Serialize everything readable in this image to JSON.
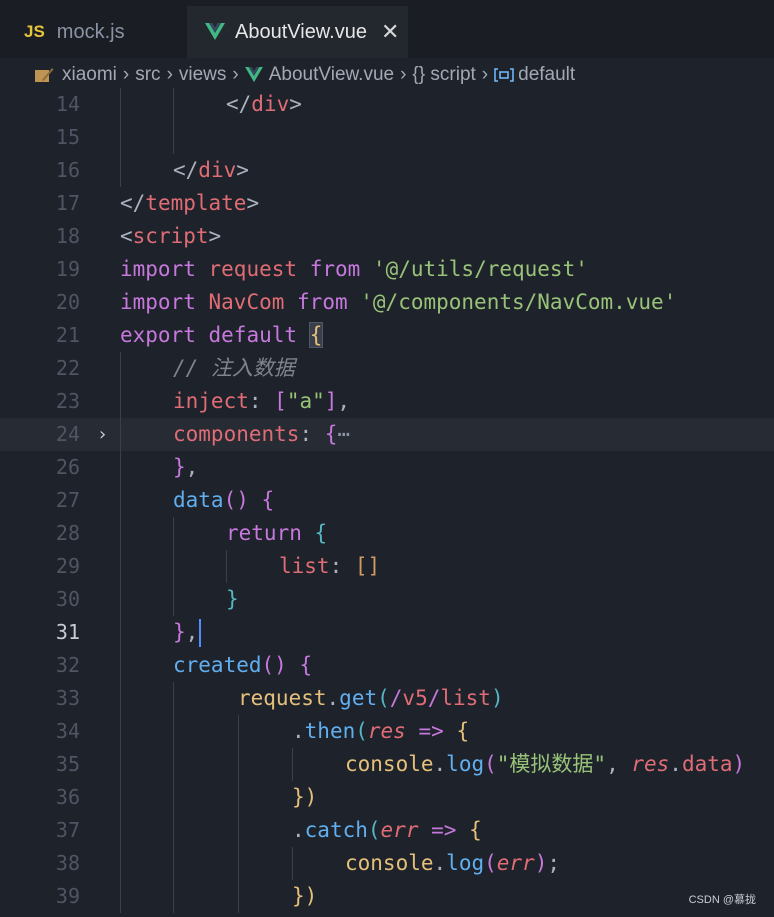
{
  "tabs": [
    {
      "icon": "js-icon",
      "icon_text": "JS",
      "label": "mock.js",
      "active": false
    },
    {
      "icon": "vue-icon",
      "label": "AboutView.vue",
      "active": true,
      "close": "✕"
    }
  ],
  "breadcrumb": [
    "xiaomi",
    "src",
    "views",
    "AboutView.vue",
    "{} script",
    "default"
  ],
  "colors": {
    "background": "#1e222a",
    "keyword": "#c678dd",
    "variable": "#e06c75",
    "string": "#98c379",
    "function": "#61afef",
    "comment": "#7f848e",
    "vue_green": "#41b883",
    "js_yellow": "#e8c53b"
  },
  "editor": {
    "active_line": "31",
    "lines": [
      {
        "n": "14",
        "tokens": [
          [
            "p",
            "</"
          ],
          [
            "tag",
            "div"
          ],
          [
            "p",
            ">"
          ]
        ]
      },
      {
        "n": "15",
        "tokens": []
      },
      {
        "n": "16",
        "tokens": [
          [
            "p",
            "</"
          ],
          [
            "tag",
            "div"
          ],
          [
            "p",
            ">"
          ]
        ]
      },
      {
        "n": "17",
        "tokens": [
          [
            "p",
            "</"
          ],
          [
            "tag",
            "template"
          ],
          [
            "p",
            ">"
          ]
        ]
      },
      {
        "n": "18",
        "tokens": [
          [
            "p",
            "<"
          ],
          [
            "tag",
            "script"
          ],
          [
            "p",
            ">"
          ]
        ]
      },
      {
        "n": "19",
        "tokens": [
          [
            "kw",
            "import"
          ],
          [
            "p",
            " "
          ],
          [
            "var",
            "request"
          ],
          [
            "p",
            " "
          ],
          [
            "kw",
            "from"
          ],
          [
            "p",
            " "
          ],
          [
            "str",
            "'@/utils/request'"
          ]
        ]
      },
      {
        "n": "20",
        "tokens": [
          [
            "kw",
            "import"
          ],
          [
            "p",
            " "
          ],
          [
            "var",
            "NavCom"
          ],
          [
            "p",
            " "
          ],
          [
            "kw",
            "from"
          ],
          [
            "p",
            " "
          ],
          [
            "str",
            "'@/components/NavCom.vue'"
          ]
        ]
      },
      {
        "n": "21",
        "tokens": [
          [
            "kw",
            "export"
          ],
          [
            "p",
            " "
          ],
          [
            "kw",
            "default"
          ],
          [
            "p",
            " "
          ],
          [
            "b1br",
            "{"
          ]
        ]
      },
      {
        "n": "22",
        "tokens": [
          [
            "com",
            "// 注入数据"
          ]
        ]
      },
      {
        "n": "23",
        "tokens": [
          [
            "prop",
            "inject"
          ],
          [
            "p",
            ": "
          ],
          [
            "b2",
            "["
          ],
          [
            "str",
            "\"a\""
          ],
          [
            "b2",
            "]"
          ],
          [
            "p",
            ","
          ]
        ]
      },
      {
        "n": "24",
        "tokens": [
          [
            "prop",
            "components"
          ],
          [
            "p",
            ": "
          ],
          [
            "b2",
            "{"
          ],
          [
            "fold",
            "⋯"
          ]
        ]
      },
      {
        "n": "26",
        "tokens": [
          [
            "b2",
            "}"
          ],
          [
            "p",
            ","
          ]
        ]
      },
      {
        "n": "27",
        "tokens": [
          [
            "fn",
            "data"
          ],
          [
            "b2",
            "()"
          ],
          [
            "p",
            " "
          ],
          [
            "b2",
            "{"
          ]
        ]
      },
      {
        "n": "28",
        "tokens": [
          [
            "kw",
            "return"
          ],
          [
            "p",
            " "
          ],
          [
            "b3",
            "{"
          ]
        ]
      },
      {
        "n": "29",
        "tokens": [
          [
            "prop",
            "list"
          ],
          [
            "p",
            ": "
          ],
          [
            "num",
            "[]"
          ]
        ]
      },
      {
        "n": "30",
        "tokens": [
          [
            "b3",
            "}"
          ]
        ]
      },
      {
        "n": "31",
        "tokens": [
          [
            "b2",
            "}"
          ],
          [
            "p",
            ","
          ]
        ]
      },
      {
        "n": "32",
        "tokens": [
          [
            "fn",
            "created"
          ],
          [
            "b2",
            "()"
          ],
          [
            "p",
            " "
          ],
          [
            "b2",
            "{"
          ]
        ]
      },
      {
        "n": "33",
        "tokens": [
          [
            "obj",
            "request"
          ],
          [
            "p",
            "."
          ],
          [
            "fn",
            "get"
          ],
          [
            "b3",
            "("
          ],
          [
            "kw",
            "/"
          ],
          [
            "tag",
            "v5"
          ],
          [
            "kw",
            "/"
          ],
          [
            "tag",
            "list"
          ],
          [
            "b3",
            ")"
          ]
        ]
      },
      {
        "n": "34",
        "tokens": [
          [
            "p",
            "."
          ],
          [
            "fn",
            "then"
          ],
          [
            "b3",
            "("
          ],
          [
            "param",
            "res"
          ],
          [
            "p",
            " "
          ],
          [
            "kw",
            "=>"
          ],
          [
            "p",
            " "
          ],
          [
            "b4",
            "{"
          ]
        ]
      },
      {
        "n": "35",
        "tokens": [
          [
            "obj",
            "console"
          ],
          [
            "p",
            "."
          ],
          [
            "fn",
            "log"
          ],
          [
            "b2",
            "("
          ],
          [
            "str",
            "\"模拟数据\""
          ],
          [
            "p",
            ", "
          ],
          [
            "param",
            "res"
          ],
          [
            "p",
            "."
          ],
          [
            "var",
            "data"
          ],
          [
            "b2",
            ")"
          ]
        ]
      },
      {
        "n": "36",
        "tokens": [
          [
            "b4",
            "})"
          ]
        ]
      },
      {
        "n": "37",
        "tokens": [
          [
            "p",
            "."
          ],
          [
            "fn",
            "catch"
          ],
          [
            "b3",
            "("
          ],
          [
            "param",
            "err"
          ],
          [
            "p",
            " "
          ],
          [
            "kw",
            "=>"
          ],
          [
            "p",
            " "
          ],
          [
            "b4",
            "{"
          ]
        ]
      },
      {
        "n": "38",
        "tokens": [
          [
            "obj",
            "console"
          ],
          [
            "p",
            "."
          ],
          [
            "fn",
            "log"
          ],
          [
            "b2",
            "("
          ],
          [
            "param",
            "err"
          ],
          [
            "b2",
            ")"
          ],
          [
            "p",
            ";"
          ]
        ]
      },
      {
        "n": "39",
        "tokens": [
          [
            "b4",
            "})"
          ]
        ]
      }
    ]
  },
  "watermark": "CSDN @慕拢"
}
